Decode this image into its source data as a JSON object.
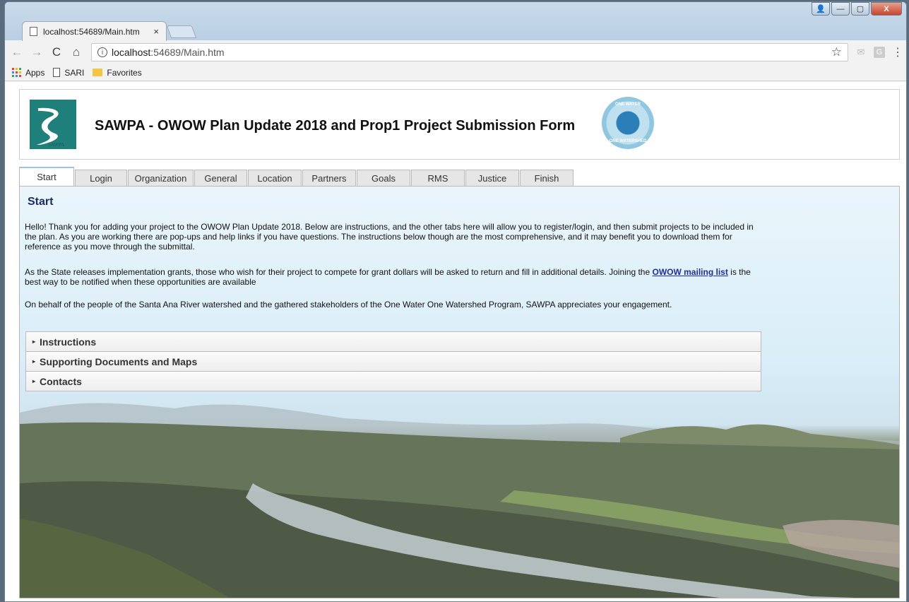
{
  "browser": {
    "tab_title": "localhost:54689/Main.htm",
    "tab_close": "×",
    "url_host": "localhost",
    "url_rest": ":54689/Main.htm",
    "info_icon": "i",
    "nav": {
      "back": "←",
      "forward": "→",
      "reload": "C",
      "home": "⌂"
    },
    "star": "☆",
    "menu": "⋮",
    "g_ext": "G",
    "bookmarks": [
      {
        "label": "Apps",
        "icon": "apps-grid-icon"
      },
      {
        "label": "SARI",
        "icon": "page-icon"
      },
      {
        "label": "Favorites",
        "icon": "folder-icon"
      }
    ],
    "window_buttons": {
      "user": "👤",
      "minimize": "—",
      "maximize": "▢",
      "close": "X"
    }
  },
  "header": {
    "title": "SAWPA - OWOW Plan Update 2018 and Prop1 Project Submission Form",
    "logo_left_text": "SAWPA",
    "logo_right_top": "ONE WATER",
    "logo_right_bottom": "ONE WATERSHED"
  },
  "tabs": [
    {
      "label": "Start",
      "active": true
    },
    {
      "label": "Login"
    },
    {
      "label": "Organization"
    },
    {
      "label": "General"
    },
    {
      "label": "Location"
    },
    {
      "label": "Partners"
    },
    {
      "label": "Goals"
    },
    {
      "label": "RMS"
    },
    {
      "label": "Justice"
    },
    {
      "label": "Finish"
    }
  ],
  "main": {
    "section_title": "Start",
    "para1": "Hello! Thank you for adding your project to the OWOW Plan Update 2018. Below are instructions, and the other tabs here will allow you to register/login, and then submit projects to be included in the plan. As you are working there are pop-ups and help links if you have questions. The instructions below though are the most comprehensive, and it may benefit you to download them for reference as you move through the submittal.",
    "para2_before": "As the State releases implementation grants, those who wish for their project to compete for grant dollars will be asked to return and fill in additional details. Joining the ",
    "para2_link": "OWOW mailing list",
    "para2_after": " is the best way to be notified when these opportunities are available",
    "para3": "On behalf of the people of the Santa Ana River watershed and the gathered stakeholders of the One Water One Watershed Program, SAWPA appreciates your engagement.",
    "accordion": [
      {
        "label": "Instructions"
      },
      {
        "label": "Supporting Documents and Maps"
      },
      {
        "label": "Contacts"
      }
    ],
    "caret": "▸"
  },
  "colors": {
    "title_blue": "#1b2c6b",
    "link_blue": "#1d2ea8",
    "sawpa_teal": "#1f7f7a"
  }
}
